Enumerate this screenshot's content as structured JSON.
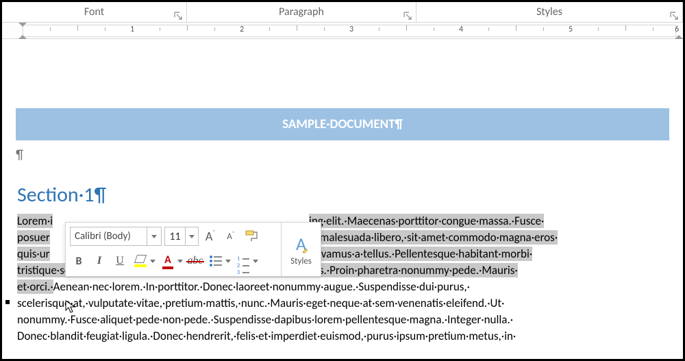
{
  "ribbon_groups": {
    "font": "Font",
    "paragraph": "Paragraph",
    "styles": "Styles"
  },
  "ruler": {
    "numbers": [
      "1",
      "2",
      "3",
      "4",
      "5",
      "6"
    ]
  },
  "doc": {
    "title": "SAMPLE·DOCUMENT¶",
    "paragraph_mark": "¶",
    "section_heading": "Section·1¶"
  },
  "mini": {
    "font_name": "Calibri (Body)",
    "font_size": "11",
    "grow_font": "A",
    "shrink_font": "A",
    "bold": "B",
    "italic": "I",
    "underline": "U",
    "strike": "abc",
    "fontcolor_letter": "A",
    "styles_label": "Styles",
    "styles_letter": "A"
  },
  "body": {
    "l1_pre": "Lorem·i",
    "l1_post": "ing·elit.·Maecenas·porttitor·congue·massa.·Fusce·",
    "l2_pre": "posuer",
    "l2_post": "us·malesuada·libero,·sit·amet·commodo·magna·eros·",
    "l3_pre": "quis·ur",
    "l3_post": ".·Vivamus·a·tellus.·Pellentesque·habitant·morbi·",
    "l4": "tristique·senectus·et·netus·et·malesuada·fames·ac·turpis·egestas.·Proin·pharetra·nonummy·pede.·Mauris·",
    "l5_sel": "et·orci.·",
    "l5_rest": "Aenean·nec·lorem.·In·porttitor.·Donec·laoreet·nonummy·augue.·Suspendisse·dui·purus,·",
    "l6": "scelerisque·at,·vulputate·vitae,·pretium·mattis,·nunc.·Mauris·eget·neque·at·sem·venenatis·eleifend.·Ut·",
    "l7": "nonummy.·Fusce·aliquet·pede·non·pede.·Suspendisse·dapibus·lorem·pellentesque·magna.·Integer·nulla.·",
    "l8": "Donec·blandit·feugiat·ligula.·Donec·hendrerit,·felis·et·imperdiet·euismod,·purus·ipsum·pretium·metus,·in·"
  }
}
